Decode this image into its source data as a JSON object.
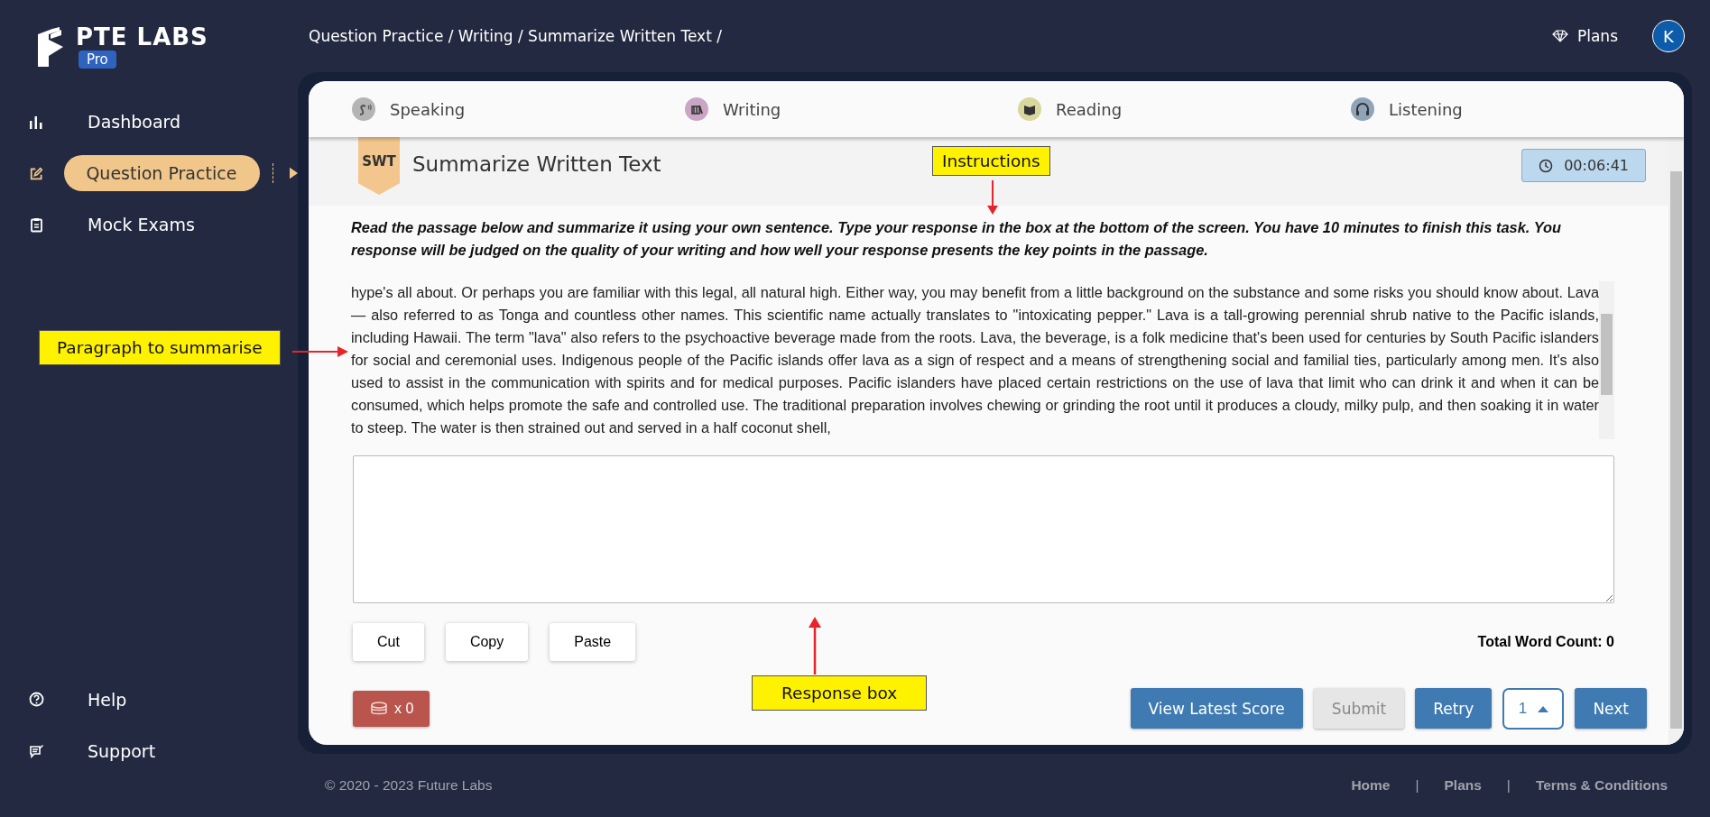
{
  "brand": {
    "name": "PTE LABS",
    "badge": "Pro"
  },
  "breadcrumb": "Question Practice / Writing / Summarize Written Text /",
  "header": {
    "plans": "Plans",
    "avatar": "K"
  },
  "sidebar": {
    "items": [
      {
        "label": "Dashboard",
        "kind": "chart",
        "selected": false
      },
      {
        "label": "Question Practice",
        "kind": "edit",
        "selected": true
      },
      {
        "label": "Mock Exams",
        "kind": "clipboard",
        "selected": false
      }
    ],
    "bottom_items": [
      {
        "label": "Help",
        "kind": "help"
      },
      {
        "label": "Support",
        "kind": "support"
      }
    ]
  },
  "tabs": [
    {
      "label": "Speaking",
      "kind": "speaking",
      "color": "#b4b4b4"
    },
    {
      "label": "Writing",
      "kind": "writing",
      "color": "#c9a6c4"
    },
    {
      "label": "Reading",
      "kind": "reading",
      "color": "#d8d79c"
    },
    {
      "label": "Listening",
      "kind": "listening",
      "color": "#8fa4b8"
    }
  ],
  "task": {
    "badge": "SWT",
    "title": "Summarize Written Text",
    "timer": "00:06:41"
  },
  "instructions": "Read the passage below and summarize it using your own sentence. Type your response in the box at the bottom of the screen. You have 10 minutes to finish this task. You response will be judged on the quality of your writing and how well your response presents the key points in the passage.",
  "passage": "hype's all about. Or perhaps you are familiar with this legal, all natural high. Either way, you may benefit from a little background on the substance and some risks you should know about. Lava — also referred to as Tonga and countless other names. This scientific name actually translates to \"intoxicating pepper.\" Lava is a tall-growing perennial shrub native to the Pacific islands, including Hawaii. The term \"lava\" also refers to the psychoactive beverage made from the roots. Lava, the beverage, is a folk medicine that's been used for centuries by South Pacific islanders for social and ceremonial uses. Indigenous people of the Pacific islands offer lava as a sign of respect and a means of strengthening social and familial ties, particularly among men. It's also used to assist in the communication with spirits and for medical purposes. Pacific islanders have placed certain restrictions on the use of lava that limit who can drink it and when it can be consumed, which helps promote the safe and controlled use. The traditional preparation involves chewing or grinding the root until it produces a cloudy, milky pulp, and then soaking it in water to steep. The water is then strained out and served in a half coconut shell,",
  "edit_buttons": [
    "Cut",
    "Copy",
    "Paste"
  ],
  "word_count": "Total Word Count: 0",
  "coins": "x 0",
  "actions": [
    {
      "label": "View Latest Score",
      "kind": "button",
      "disabled": false
    },
    {
      "label": "Submit",
      "kind": "button",
      "disabled": true
    },
    {
      "label": "Retry",
      "kind": "button",
      "disabled": false
    },
    {
      "label": "1",
      "kind": "pager"
    },
    {
      "label": "Next",
      "kind": "button",
      "disabled": false
    }
  ],
  "annotations": [
    {
      "label": "Instructions",
      "kind": "down"
    },
    {
      "label": "Paragraph to summarise",
      "kind": "right"
    },
    {
      "label": "Response box",
      "kind": "up"
    }
  ],
  "footer": {
    "copyright": "© 2020 - 2023 Future Labs",
    "links": [
      "Home",
      "Plans",
      "Terms & Conditions"
    ],
    "separator": "|"
  }
}
